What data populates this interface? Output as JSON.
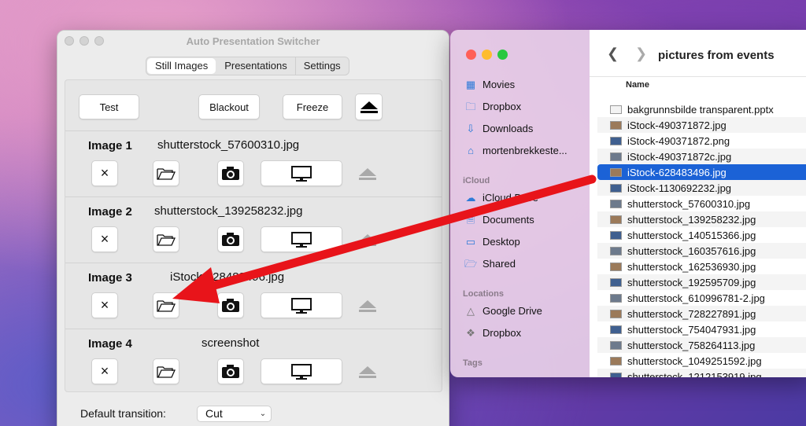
{
  "aps": {
    "title": "Auto Presentation Switcher",
    "tabs": [
      "Still Images",
      "Presentations",
      "Settings"
    ],
    "buttons": {
      "test": "Test",
      "blackout": "Blackout",
      "freeze": "Freeze"
    },
    "images": [
      {
        "label": "Image 1",
        "file": "shutterstock_57600310.jpg"
      },
      {
        "label": "Image 2",
        "file": "shutterstock_139258232.jpg"
      },
      {
        "label": "Image 3",
        "file": "iStock-628483496.jpg"
      },
      {
        "label": "Image 4",
        "file": "screenshot"
      }
    ],
    "remove_symbol": "×",
    "default_transition_label": "Default transition:",
    "default_transition_value": "Cut"
  },
  "finder": {
    "title": "pictures from events",
    "column_header": "Name",
    "sidebar": {
      "favorites": [
        {
          "label": "Movies",
          "icon": "film-icon"
        },
        {
          "label": "Dropbox",
          "icon": "folder-icon"
        },
        {
          "label": "Downloads",
          "icon": "download-icon"
        },
        {
          "label": "mortenbrekkeste...",
          "icon": "home-icon"
        }
      ],
      "icloud_header": "iCloud",
      "icloud": [
        {
          "label": "iCloud Drive",
          "icon": "cloud-icon"
        },
        {
          "label": "Documents",
          "icon": "document-icon"
        },
        {
          "label": "Desktop",
          "icon": "desktop-icon"
        },
        {
          "label": "Shared",
          "icon": "shared-folder-icon"
        }
      ],
      "locations_header": "Locations",
      "locations": [
        {
          "label": "Google Drive",
          "icon": "drive-icon"
        },
        {
          "label": "Dropbox",
          "icon": "dropbox-icon"
        }
      ],
      "tags_header": "Tags"
    },
    "files": [
      "bakgrunnsbilde transparent.pptx",
      "iStock-490371872.jpg",
      "iStock-490371872.png",
      "iStock-490371872c.jpg",
      "iStock-628483496.jpg",
      "iStock-1130692232.jpg",
      "shutterstock_57600310.jpg",
      "shutterstock_139258232.jpg",
      "shutterstock_140515366.jpg",
      "shutterstock_160357616.jpg",
      "shutterstock_162536930.jpg",
      "shutterstock_192595709.jpg",
      "shutterstock_610996781-2.jpg",
      "shutterstock_728227891.jpg",
      "shutterstock_754047931.jpg",
      "shutterstock_758264113.jpg",
      "shutterstock_1049251592.jpg",
      "shutterstock_1212153919.jpg"
    ],
    "selected_index": 4
  },
  "colors": {
    "selection": "#1b62d6",
    "annotation_arrow": "#e8141a",
    "close": "#ff5f57",
    "minimize": "#febc2e",
    "zoom": "#28c840"
  }
}
